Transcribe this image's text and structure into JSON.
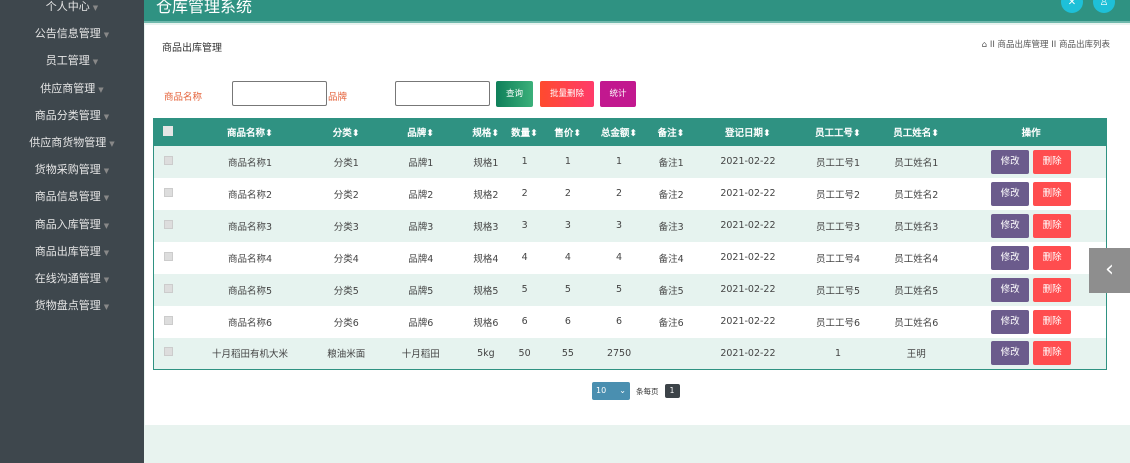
{
  "app_title": "仓库管理系统",
  "sidebar": {
    "items": [
      "个人中心",
      "公告信息管理",
      "员工管理",
      "供应商管理",
      "商品分类管理",
      "供应商货物管理",
      "货物采购管理",
      "商品信息管理",
      "商品入库管理",
      "商品出库管理",
      "在线沟通管理",
      "货物盘点管理"
    ]
  },
  "page_title": "商品出库管理",
  "breadcrumb": {
    "sep": "II",
    "items": [
      "商品出库管理",
      "商品出库列表"
    ]
  },
  "search": {
    "name_label": "商品名称",
    "name_value": "",
    "brand_label": "品牌",
    "brand_value": ""
  },
  "buttons": {
    "query": "查询",
    "batch_delete": "批量删除",
    "stats": "统计",
    "edit": "修改",
    "delete": "删除"
  },
  "colors": {
    "header": "#2f9282",
    "query": "#1f9a6a",
    "batch_delete": "#ff4a3d",
    "stats": "#c2188f",
    "edit": "#6b5b8c",
    "delete": "#ff4d4f"
  },
  "table": {
    "columns": [
      "商品名称",
      "分类",
      "品牌",
      "规格",
      "数量",
      "售价",
      "总金额",
      "备注",
      "登记日期",
      "员工工号",
      "员工姓名",
      "操作"
    ],
    "rows": [
      [
        "商品名称1",
        "分类1",
        "品牌1",
        "规格1",
        "1",
        "1",
        "1",
        "备注1",
        "2021-02-22",
        "员工工号1",
        "员工姓名1"
      ],
      [
        "商品名称2",
        "分类2",
        "品牌2",
        "规格2",
        "2",
        "2",
        "2",
        "备注2",
        "2021-02-22",
        "员工工号2",
        "员工姓名2"
      ],
      [
        "商品名称3",
        "分类3",
        "品牌3",
        "规格3",
        "3",
        "3",
        "3",
        "备注3",
        "2021-02-22",
        "员工工号3",
        "员工姓名3"
      ],
      [
        "商品名称4",
        "分类4",
        "品牌4",
        "规格4",
        "4",
        "4",
        "4",
        "备注4",
        "2021-02-22",
        "员工工号4",
        "员工姓名4"
      ],
      [
        "商品名称5",
        "分类5",
        "品牌5",
        "规格5",
        "5",
        "5",
        "5",
        "备注5",
        "2021-02-22",
        "员工工号5",
        "员工姓名5"
      ],
      [
        "商品名称6",
        "分类6",
        "品牌6",
        "规格6",
        "6",
        "6",
        "6",
        "备注6",
        "2021-02-22",
        "员工工号6",
        "员工姓名6"
      ],
      [
        "十月稻田有机大米",
        "粮油米面",
        "十月稻田",
        "5kg",
        "50",
        "55",
        "2750",
        "",
        "2021-02-22",
        "1",
        "王明"
      ]
    ]
  },
  "pagination": {
    "page_size": "10",
    "per_page_label": "条每页",
    "current_page": "1"
  }
}
